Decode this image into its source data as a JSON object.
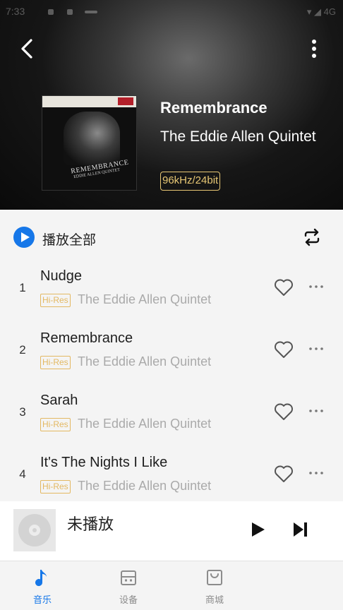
{
  "status_bar": {
    "time": "7:33",
    "right": "▾ ◢ 4G"
  },
  "album": {
    "title": "Remembrance",
    "artist": "The Eddie Allen Quintet",
    "quality": "96kHz/24bit",
    "cover_text": {
      "title": "REMEMBRANCE",
      "subtitle": "EDDIE ALLEN QUINTET"
    }
  },
  "play_all": {
    "label": "播放全部"
  },
  "tracks": [
    {
      "num": "1",
      "title": "Nudge",
      "badge": "Hi-Res",
      "artist": "The Eddie Allen Quintet"
    },
    {
      "num": "2",
      "title": "Remembrance",
      "badge": "Hi-Res",
      "artist": "The Eddie Allen Quintet"
    },
    {
      "num": "3",
      "title": "Sarah",
      "badge": "Hi-Res",
      "artist": "The Eddie Allen Quintet"
    },
    {
      "num": "4",
      "title": "It's The Nights I Like",
      "badge": "Hi-Res",
      "artist": "The Eddie Allen Quintet"
    }
  ],
  "mini_player": {
    "title": "未播放"
  },
  "tabs": [
    {
      "label": "音乐",
      "icon": "music-note-icon"
    },
    {
      "label": "设备",
      "icon": "device-icon"
    },
    {
      "label": "商城",
      "icon": "shopping-bag-icon"
    }
  ],
  "colors": {
    "accent": "#1677e8",
    "gold": "#e3b862",
    "inactive": "#8c8c8c"
  }
}
